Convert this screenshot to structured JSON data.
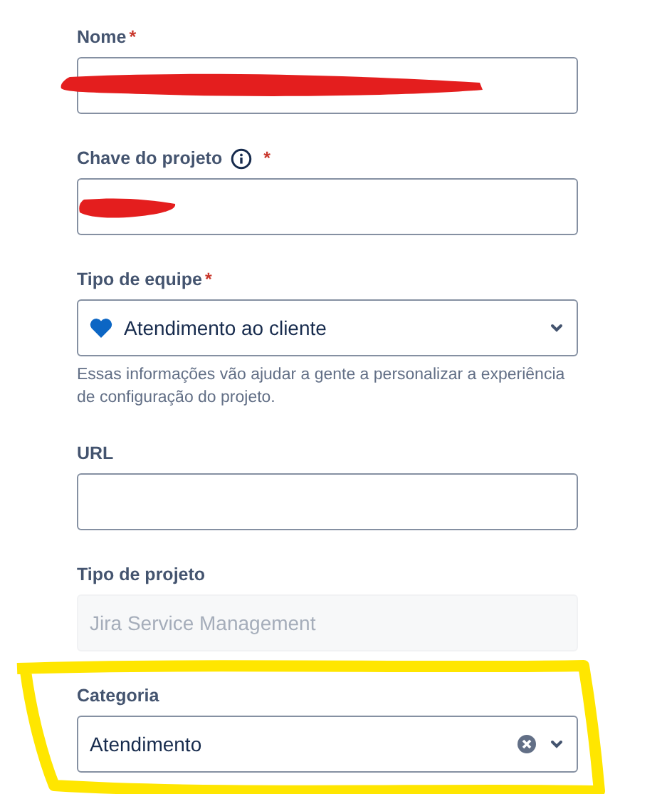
{
  "fields": [
    {
      "kind": "text",
      "label": "Nome",
      "required_mark": "*",
      "redacted": true
    },
    {
      "kind": "text",
      "label": "Chave do projeto",
      "info": true,
      "required_mark": "*",
      "redacted": true
    },
    {
      "kind": "select",
      "label": "Tipo de equipe",
      "required_mark": "*",
      "icon": true,
      "value": "Atendimento ao cliente",
      "helper": "Essas informações vão ajudar a gente a personalizar a experiência de configuração do projeto."
    },
    {
      "kind": "text",
      "label": "URL"
    },
    {
      "kind": "disabled",
      "label": "Tipo de projeto",
      "value": "Jira Service Management"
    },
    {
      "kind": "select",
      "label": "Categoria",
      "value": "Atendimento",
      "clearable": true,
      "highlighted": true
    }
  ]
}
